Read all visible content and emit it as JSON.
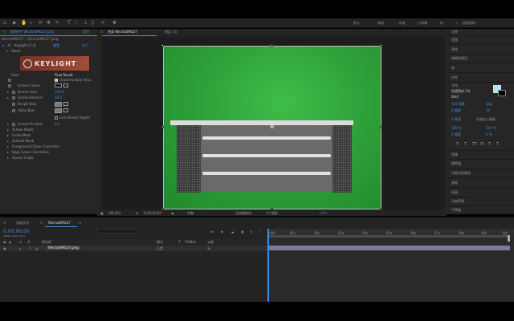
{
  "topbar": {
    "icons": [
      "home-icon",
      "select-icon",
      "hand-icon",
      "zoom-icon",
      "camera-icon",
      "pan-icon",
      "pen-icon",
      "text-icon",
      "brush-icon",
      "clone-icon",
      "eraser-icon",
      "roto-icon",
      "puppet-icon"
    ],
    "menu": [
      "默认",
      "审阅",
      "标准",
      "小屏幕",
      "库"
    ],
    "search_placeholder": "搜索帮助"
  },
  "left_panel": {
    "tabs": [
      "效果控件 WechatIMG27.jpeg",
      "≡",
      "项目"
    ],
    "breadcrumb": "WechatIMG27 • WechatIMG27.jpeg",
    "effect_name": "Keylight (1.2)",
    "reset": "重置",
    "about_link": "关于...",
    "about": "About",
    "logo_text": "KEYLIGHT",
    "rows": [
      {
        "label": "View",
        "value": "Final Result"
      },
      {
        "label": "",
        "value": "Unpremultiply Resu"
      },
      {
        "label": "Screen Colour",
        "value": ""
      },
      {
        "label": "Screen Gain",
        "value": "100.0"
      },
      {
        "label": "Screen Balance",
        "value": "50.0"
      },
      {
        "label": "Despill Bias",
        "value": ""
      },
      {
        "label": "Alpha Bias",
        "value": ""
      },
      {
        "label": "",
        "value": "Lock Biases Togeth"
      },
      {
        "label": "Screen Pre-blur",
        "value": "0.0"
      },
      {
        "label": "Screen Matte",
        "value": ""
      },
      {
        "label": "Inside Mask",
        "value": ""
      },
      {
        "label": "Outside Mask",
        "value": ""
      },
      {
        "label": "Foreground Colour Correction",
        "value": ""
      },
      {
        "label": "Edge Colour Correction",
        "value": ""
      },
      {
        "label": "Source Crops",
        "value": ""
      }
    ]
  },
  "composition": {
    "tab": "合成 WechatIMG27",
    "layer_tab": "图层 (无)",
    "bottom": {
      "zoom": "(99.6%)",
      "timecode": "0;00;00;00",
      "quality": "完整",
      "camera": "活动摄像机",
      "views": "1个视图",
      "exposure": "+0.0"
    }
  },
  "right_panel": {
    "items_top": [
      "信息",
      "音频",
      "预览",
      "效果和预设",
      "库",
      "对齐",
      "字符"
    ],
    "font": "思源黑体 CN",
    "style": "Bold",
    "font_size": "181 像素",
    "leading": "自动",
    "kerning": "0 度量",
    "tracking": "14",
    "stroke": "0 像素",
    "stroke_style": "在描边上填充",
    "vscale": "100 %",
    "hscale": "100 %",
    "baseline": "0 像素",
    "tsume": "0 %",
    "text_buttons": [
      "T",
      "T",
      "TT",
      "Tt",
      "T",
      "T,"
    ],
    "items_bottom": [
      "段落",
      "跟踪器",
      "内容识别填充",
      "画笔",
      "绘画",
      "动态草图",
      "平滑器",
      "摇摆器",
      "蒙版插值"
    ]
  },
  "timeline": {
    "tabs": [
      "渲染队列",
      "WechatIMG27"
    ],
    "timecode": "0;00;00;00",
    "fps_info": "00000 (29.97 fps)",
    "columns": [
      "#",
      "源名称",
      "模式",
      "T",
      "TrkMat",
      "父级"
    ],
    "layer": {
      "index": "1",
      "name": "WechatIMG27.jpeg",
      "mode": "正常",
      "parent": "无"
    },
    "ruler_labels": [
      ":00s",
      "01s",
      "02s",
      "03s",
      "04s",
      "05s",
      "06s",
      "07s",
      "08s",
      "09s",
      "10s"
    ]
  },
  "colors": {
    "accent": "#3d8de8",
    "green_screen": "#2fa23a",
    "layer_bar": "#7a7a9a"
  }
}
